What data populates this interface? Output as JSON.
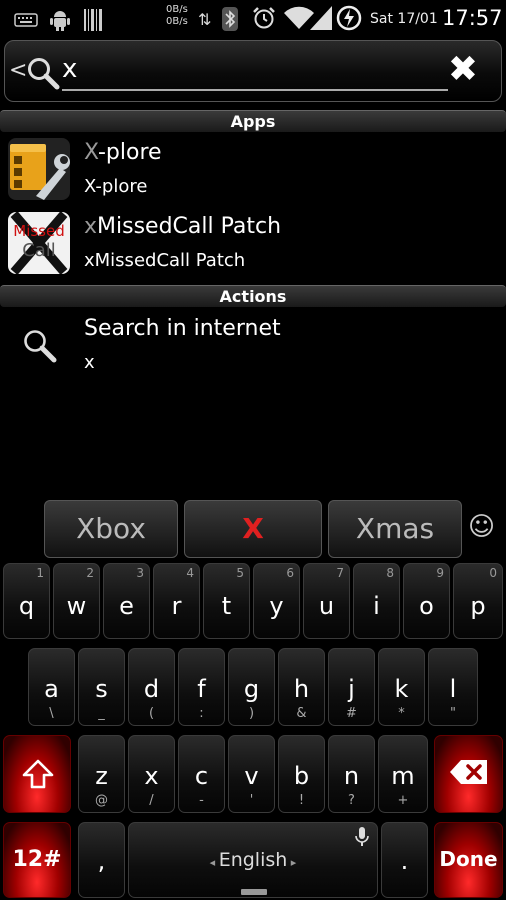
{
  "status_bar": {
    "net_up": "0B/s",
    "net_down": "0B/s",
    "date": "Sat 17/01",
    "time": "17:57"
  },
  "search": {
    "back_glyph": "<",
    "query": "x",
    "clear_glyph": "✖"
  },
  "sections": {
    "apps": "Apps",
    "actions": "Actions"
  },
  "apps": [
    {
      "title_hl": "X",
      "title_rest": "-plore",
      "subtitle": "X-plore"
    },
    {
      "title_hl": "x",
      "title_rest": "MissedCall Patch",
      "subtitle": "xMissedCall Patch",
      "icon_text_1": "Missed",
      "icon_text_2": "Call"
    }
  ],
  "actions": [
    {
      "title": "Search in internet",
      "subtitle": "x"
    }
  ],
  "suggestions": [
    "Xbox",
    "X",
    "Xmas"
  ],
  "keyboard": {
    "row1": [
      {
        "k": "q",
        "h": "1"
      },
      {
        "k": "w",
        "h": "2"
      },
      {
        "k": "e",
        "h": "3"
      },
      {
        "k": "r",
        "h": "4"
      },
      {
        "k": "t",
        "h": "5"
      },
      {
        "k": "y",
        "h": "6"
      },
      {
        "k": "u",
        "h": "7"
      },
      {
        "k": "i",
        "h": "8"
      },
      {
        "k": "o",
        "h": "9"
      },
      {
        "k": "p",
        "h": "0"
      }
    ],
    "row2": [
      {
        "k": "a",
        "s": "\\"
      },
      {
        "k": "s",
        "s": "_"
      },
      {
        "k": "d",
        "s": "("
      },
      {
        "k": "f",
        "s": ":"
      },
      {
        "k": "g",
        "s": ")"
      },
      {
        "k": "h",
        "s": "&"
      },
      {
        "k": "j",
        "s": "#"
      },
      {
        "k": "k",
        "s": "*"
      },
      {
        "k": "l",
        "s": "\""
      }
    ],
    "row3": [
      {
        "k": "z",
        "s": "@"
      },
      {
        "k": "x",
        "s": "/"
      },
      {
        "k": "c",
        "s": "-"
      },
      {
        "k": "v",
        "s": "'"
      },
      {
        "k": "b",
        "s": "!"
      },
      {
        "k": "n",
        "s": "?"
      },
      {
        "k": "m",
        "s": "+"
      }
    ],
    "symbols_label": "12#",
    "comma": ",",
    "space_label": "English",
    "period": ".",
    "done_label": "Done",
    "emoji_glyph": "☺"
  }
}
